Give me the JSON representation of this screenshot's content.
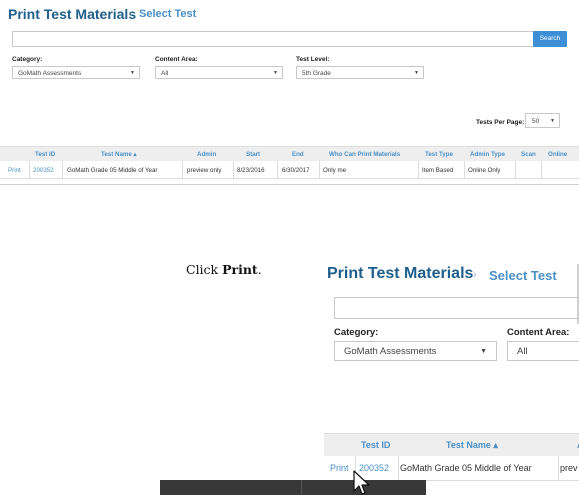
{
  "page": {
    "title": "Print Test Materials",
    "breadcrumb_sep": "›",
    "breadcrumb": "Select Test"
  },
  "search": {
    "placeholder": "",
    "button_label": "Search"
  },
  "filters": {
    "category_label": "Category:",
    "category_value": "GoMath Assessments",
    "content_area_label": "Content Area:",
    "content_area_value": "All",
    "test_level_label": "Test Level:",
    "test_level_value": "5th Grade",
    "dropdown_arrow": "▼"
  },
  "paging": {
    "label": "Tests Per Page:",
    "value": "50"
  },
  "table": {
    "headers": [
      "Test ID",
      "Test Name ▴",
      "Admin",
      "Start",
      "End",
      "Who Can Print Materials",
      "Test Type",
      "Admin Type",
      "Scan",
      "Online"
    ],
    "rows": [
      {
        "action": "Print",
        "test_id": "200352",
        "test_name": "GoMath Grade 05 Middle of Year",
        "admin": "preview only",
        "start": "8/23/2016",
        "end": "6/30/2017",
        "who_can_print": "Only me",
        "test_type": "Item Based",
        "admin_type": "Online Only",
        "scan": "",
        "online": ""
      }
    ]
  },
  "zoom": {
    "admin_truncated": "prev",
    "extra_header_truncated": "A"
  },
  "caption": {
    "prefix": "Click ",
    "bold": "Print",
    "suffix": "."
  },
  "icons": {
    "cursor": "mouse-pointer-icon",
    "dropdown": "chevron-down-icon"
  },
  "colors": {
    "title": "#1f5f8b",
    "link": "#4a90c8",
    "button": "#3d8fd6",
    "header_bg": "#eeeeee"
  }
}
